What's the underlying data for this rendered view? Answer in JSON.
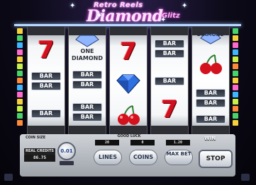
{
  "logo": {
    "line1": "Retro Reels",
    "line2": "Diamond",
    "line3": "Glitz"
  },
  "reels": [
    {
      "symbols": [
        "7",
        "BAR",
        "BAR"
      ]
    },
    {
      "symbols": [
        "ONE DIAMOND",
        "BAR",
        "BAR"
      ]
    },
    {
      "symbols": [
        "7",
        "DIAMOND",
        "CHERRY"
      ]
    },
    {
      "symbols": [
        "BAR",
        "BAR",
        "7"
      ]
    },
    {
      "symbols": [
        "DIAMOND",
        "CHERRY",
        "BAR"
      ]
    }
  ],
  "panel": {
    "real_credits_label": "REAL CREDITS",
    "coin_size_label": "COIN SIZE",
    "credits_value": "86.75",
    "coin_value": "0.01",
    "good_luck": "GOOD LUCK",
    "lines_value": "20",
    "coins_value": "0",
    "bet_value": "1.20",
    "lines_label": "LINES",
    "coins_label": "COINS",
    "maxbet_label": "MAX BET",
    "win_label": "WIN",
    "stop_label": "STOP"
  },
  "colors": {
    "seven": "#d10f1f",
    "bar": "#2a2f3a",
    "diamond": "#2f6fe0",
    "cherry": "#d4121e"
  }
}
